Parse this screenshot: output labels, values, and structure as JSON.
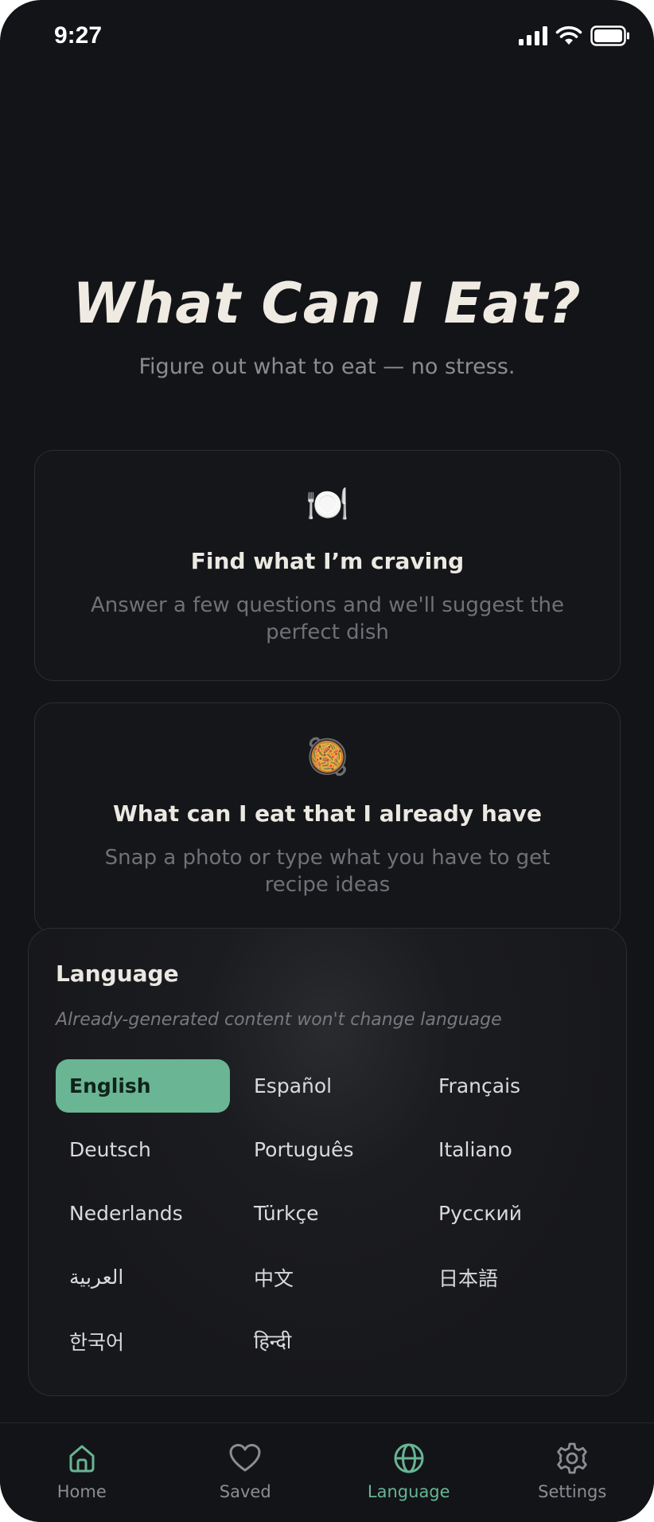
{
  "status_bar": {
    "time": "9:27"
  },
  "hero": {
    "title": "What Can I Eat?",
    "subtitle": "Figure out what to eat — no stress."
  },
  "cards": [
    {
      "emoji": "🍽️",
      "title": "Find what I’m craving",
      "description": "Answer a few questions and we'll suggest the perfect dish"
    },
    {
      "emoji": "🥘",
      "title": "What can I eat that I already have",
      "description": "Snap a photo or type what you have to get recipe ideas"
    }
  ],
  "language_panel": {
    "title": "Language",
    "note": "Already-generated content won't change language",
    "selected": "English",
    "options": [
      "English",
      "Español",
      "Français",
      "Deutsch",
      "Português",
      "Italiano",
      "Nederlands",
      "Türkçe",
      "Русский",
      "العربية",
      "中文",
      "日本語",
      "한국어",
      "हिन्दी"
    ]
  },
  "bottom_nav": {
    "active": "Language",
    "items": [
      {
        "label": "Home",
        "icon": "home-icon"
      },
      {
        "label": "Saved",
        "icon": "heart-icon"
      },
      {
        "label": "Language",
        "icon": "globe-icon"
      },
      {
        "label": "Settings",
        "icon": "gear-icon"
      }
    ]
  },
  "colors": {
    "background": "#131417",
    "accent": "#67b594",
    "selected_language_bg": "#69b594",
    "text_primary": "#efebe2",
    "text_muted": "#6f7176"
  }
}
